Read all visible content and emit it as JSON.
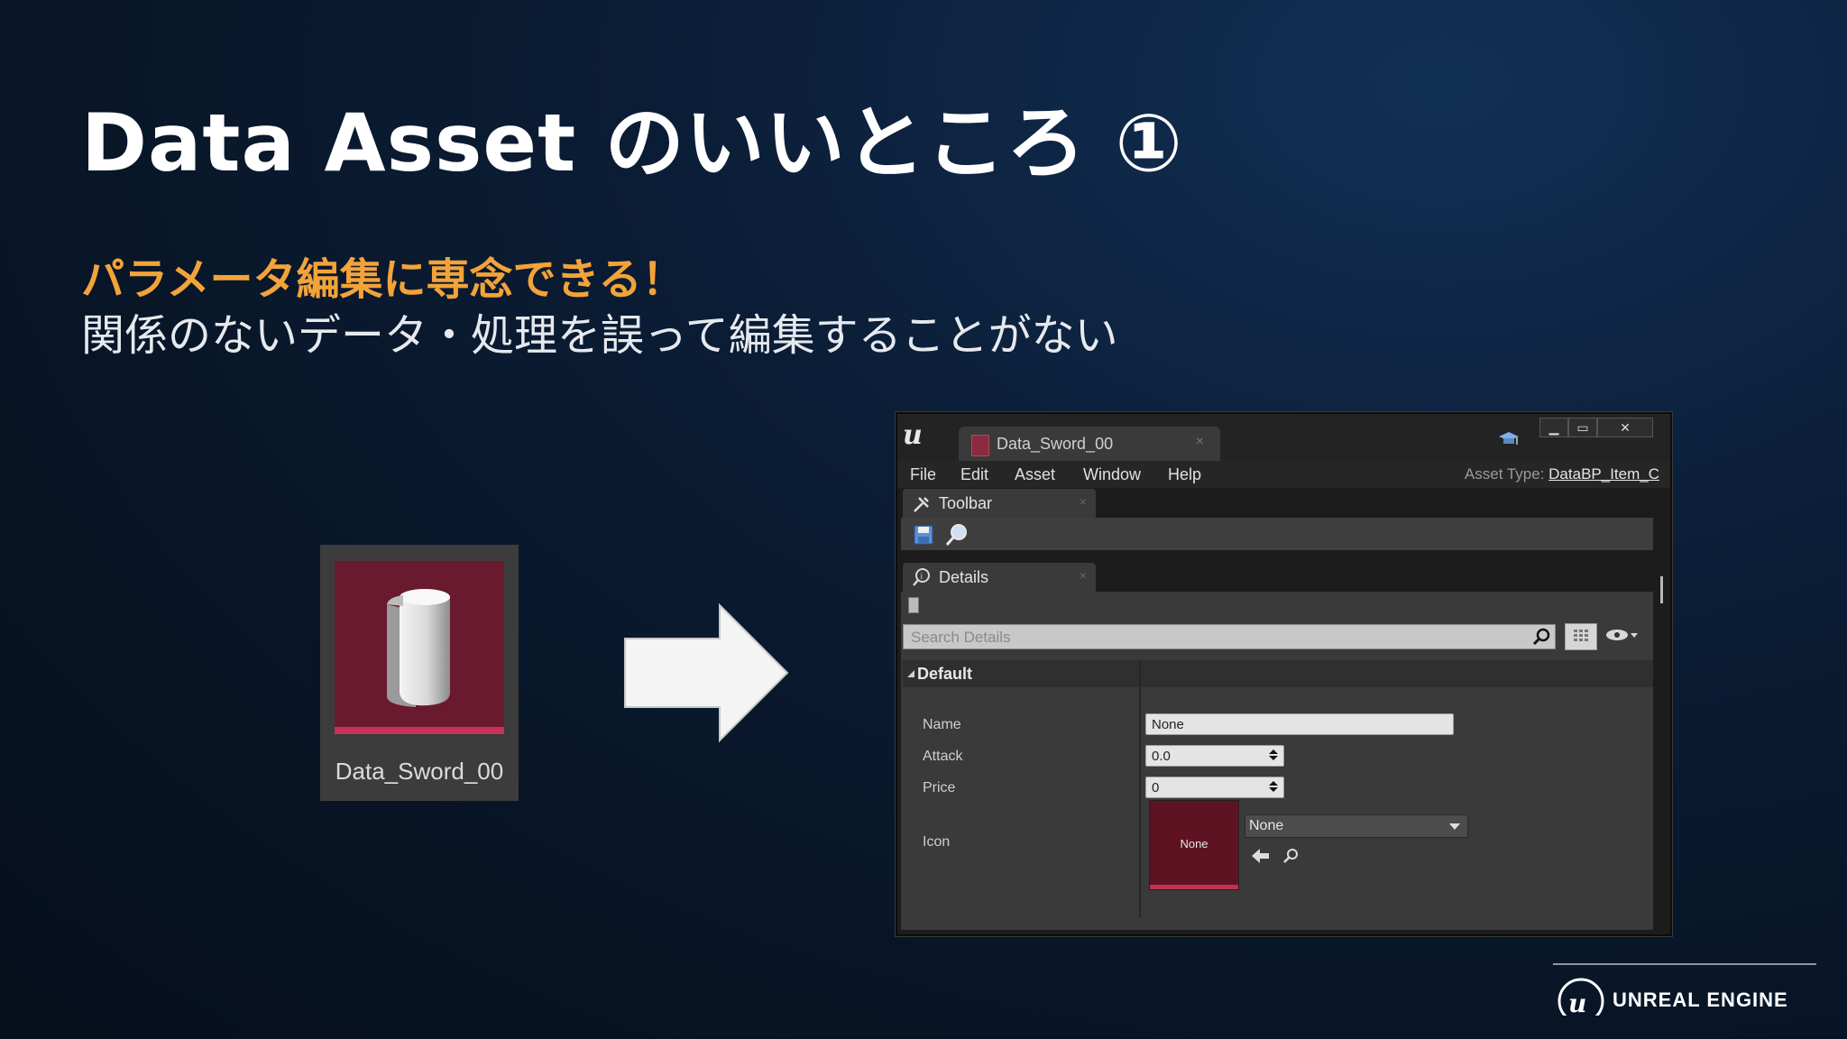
{
  "slide": {
    "title": "Data Asset のいいところ ①",
    "subtitle": "パラメータ編集に専念できる！",
    "description": "関係のないデータ・処理を誤って編集することがない"
  },
  "asset_tile": {
    "label": "Data_Sword_00"
  },
  "editor": {
    "tab_title": "Data_Sword_00",
    "tab_close": "×",
    "window_buttons": {
      "minimize": "▁",
      "maximize": "▭",
      "close": "✕"
    },
    "menu": [
      "File",
      "Edit",
      "Asset",
      "Window",
      "Help"
    ],
    "asset_type_label": "Asset Type:",
    "asset_type_value": "DataBP_Item_C",
    "toolbar_tab": "Toolbar",
    "details_tab": "Details",
    "search_placeholder": "Search Details",
    "category": "Default",
    "properties": {
      "name_label": "Name",
      "name_value": "None",
      "attack_label": "Attack",
      "attack_value": "0.0",
      "price_label": "Price",
      "price_value": "0",
      "icon_label": "Icon",
      "icon_thumb_text": "None",
      "icon_combo_value": "None"
    }
  },
  "brand": {
    "text": "UNREAL ENGINE"
  },
  "colors": {
    "accent": "#f2a33a",
    "asset_red": "#6a1a2e",
    "asset_bar": "#c7325a",
    "bg": "#0b1d36"
  }
}
